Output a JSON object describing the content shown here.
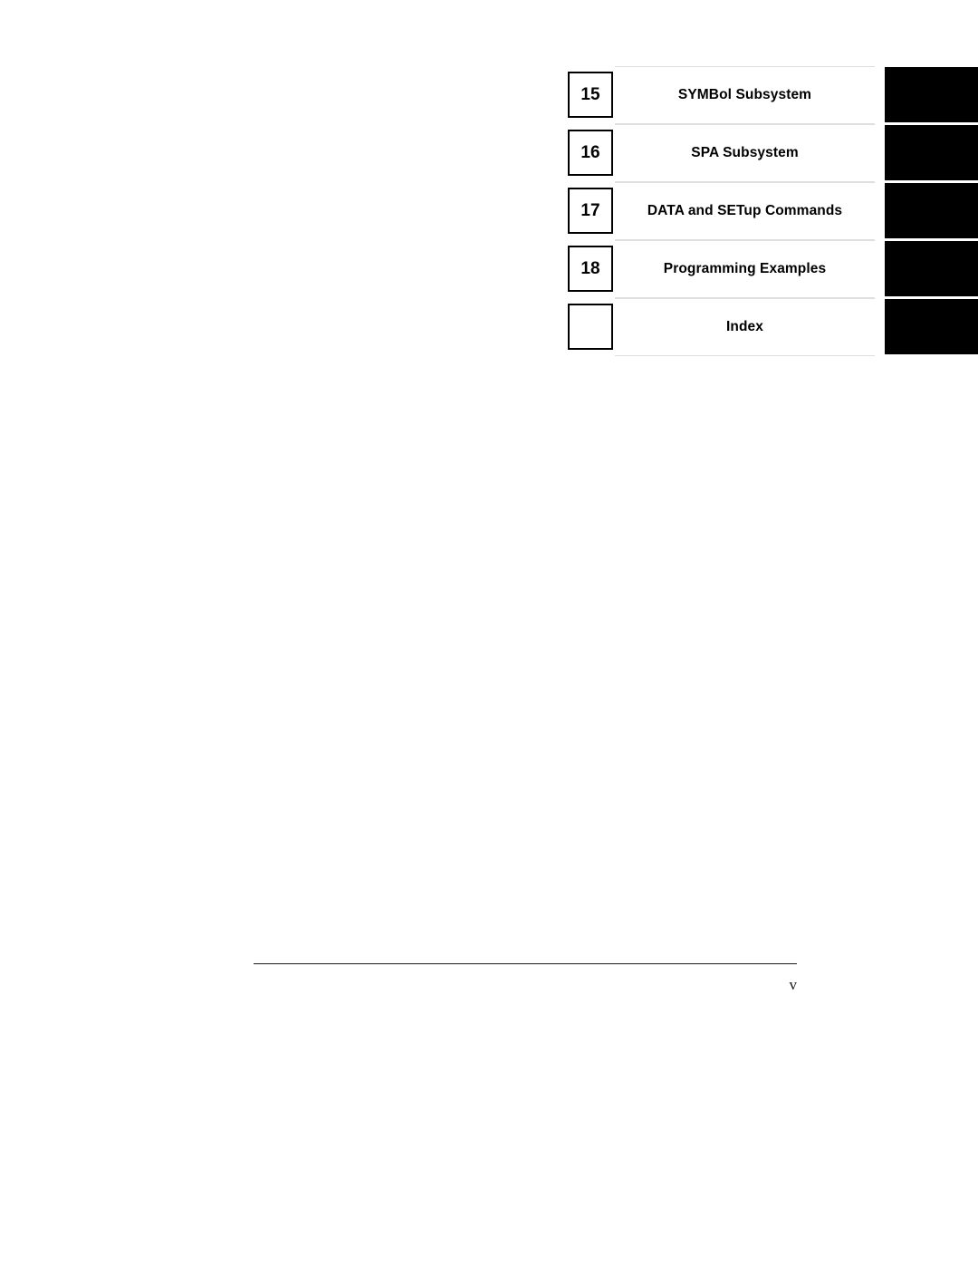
{
  "document": {
    "page_number": "v",
    "footer_rule": true
  },
  "tab_index": {
    "rows": [
      {
        "number": "15",
        "title": "SYMBol Subsystem",
        "marker_color": "#000000"
      },
      {
        "number": "16",
        "title": "SPA Subsystem",
        "marker_color": "#000000"
      },
      {
        "number": "17",
        "title": "DATA and SETup Commands",
        "marker_color": "#000000"
      },
      {
        "number": "18",
        "title": "Programming Examples",
        "marker_color": "#000000"
      },
      {
        "number": "",
        "title": "Index",
        "marker_color": "#000000"
      }
    ]
  },
  "colors": {
    "page_background": "#ffffff",
    "text": "#000000",
    "row_rule": "#dedede",
    "box_border": "#000000",
    "marker": "#000000",
    "footer_rule": "#1a1a1a"
  }
}
